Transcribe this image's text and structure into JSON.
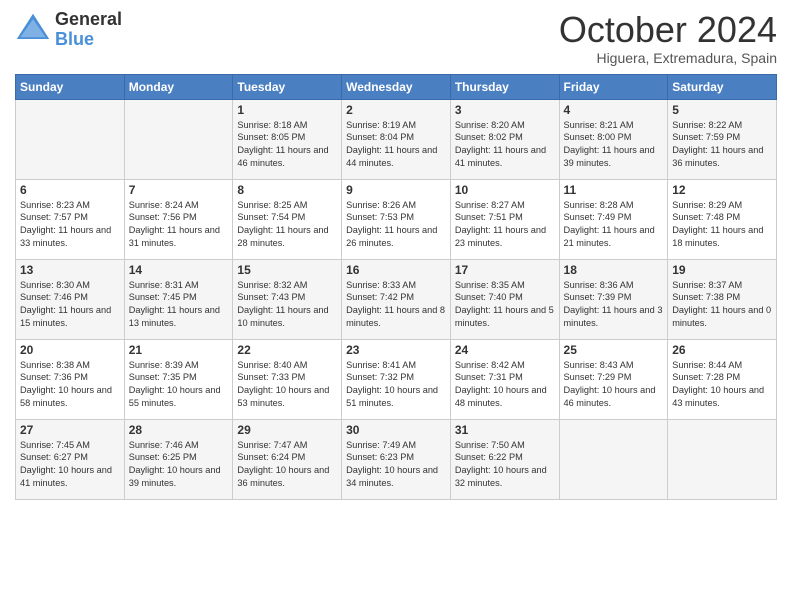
{
  "header": {
    "logo_line1": "General",
    "logo_line2": "Blue",
    "month": "October 2024",
    "location": "Higuera, Extremadura, Spain"
  },
  "days_of_week": [
    "Sunday",
    "Monday",
    "Tuesday",
    "Wednesday",
    "Thursday",
    "Friday",
    "Saturday"
  ],
  "weeks": [
    [
      {
        "day": "",
        "info": ""
      },
      {
        "day": "",
        "info": ""
      },
      {
        "day": "1",
        "info": "Sunrise: 8:18 AM\nSunset: 8:05 PM\nDaylight: 11 hours and 46 minutes."
      },
      {
        "day": "2",
        "info": "Sunrise: 8:19 AM\nSunset: 8:04 PM\nDaylight: 11 hours and 44 minutes."
      },
      {
        "day": "3",
        "info": "Sunrise: 8:20 AM\nSunset: 8:02 PM\nDaylight: 11 hours and 41 minutes."
      },
      {
        "day": "4",
        "info": "Sunrise: 8:21 AM\nSunset: 8:00 PM\nDaylight: 11 hours and 39 minutes."
      },
      {
        "day": "5",
        "info": "Sunrise: 8:22 AM\nSunset: 7:59 PM\nDaylight: 11 hours and 36 minutes."
      }
    ],
    [
      {
        "day": "6",
        "info": "Sunrise: 8:23 AM\nSunset: 7:57 PM\nDaylight: 11 hours and 33 minutes."
      },
      {
        "day": "7",
        "info": "Sunrise: 8:24 AM\nSunset: 7:56 PM\nDaylight: 11 hours and 31 minutes."
      },
      {
        "day": "8",
        "info": "Sunrise: 8:25 AM\nSunset: 7:54 PM\nDaylight: 11 hours and 28 minutes."
      },
      {
        "day": "9",
        "info": "Sunrise: 8:26 AM\nSunset: 7:53 PM\nDaylight: 11 hours and 26 minutes."
      },
      {
        "day": "10",
        "info": "Sunrise: 8:27 AM\nSunset: 7:51 PM\nDaylight: 11 hours and 23 minutes."
      },
      {
        "day": "11",
        "info": "Sunrise: 8:28 AM\nSunset: 7:49 PM\nDaylight: 11 hours and 21 minutes."
      },
      {
        "day": "12",
        "info": "Sunrise: 8:29 AM\nSunset: 7:48 PM\nDaylight: 11 hours and 18 minutes."
      }
    ],
    [
      {
        "day": "13",
        "info": "Sunrise: 8:30 AM\nSunset: 7:46 PM\nDaylight: 11 hours and 15 minutes."
      },
      {
        "day": "14",
        "info": "Sunrise: 8:31 AM\nSunset: 7:45 PM\nDaylight: 11 hours and 13 minutes."
      },
      {
        "day": "15",
        "info": "Sunrise: 8:32 AM\nSunset: 7:43 PM\nDaylight: 11 hours and 10 minutes."
      },
      {
        "day": "16",
        "info": "Sunrise: 8:33 AM\nSunset: 7:42 PM\nDaylight: 11 hours and 8 minutes."
      },
      {
        "day": "17",
        "info": "Sunrise: 8:35 AM\nSunset: 7:40 PM\nDaylight: 11 hours and 5 minutes."
      },
      {
        "day": "18",
        "info": "Sunrise: 8:36 AM\nSunset: 7:39 PM\nDaylight: 11 hours and 3 minutes."
      },
      {
        "day": "19",
        "info": "Sunrise: 8:37 AM\nSunset: 7:38 PM\nDaylight: 11 hours and 0 minutes."
      }
    ],
    [
      {
        "day": "20",
        "info": "Sunrise: 8:38 AM\nSunset: 7:36 PM\nDaylight: 10 hours and 58 minutes."
      },
      {
        "day": "21",
        "info": "Sunrise: 8:39 AM\nSunset: 7:35 PM\nDaylight: 10 hours and 55 minutes."
      },
      {
        "day": "22",
        "info": "Sunrise: 8:40 AM\nSunset: 7:33 PM\nDaylight: 10 hours and 53 minutes."
      },
      {
        "day": "23",
        "info": "Sunrise: 8:41 AM\nSunset: 7:32 PM\nDaylight: 10 hours and 51 minutes."
      },
      {
        "day": "24",
        "info": "Sunrise: 8:42 AM\nSunset: 7:31 PM\nDaylight: 10 hours and 48 minutes."
      },
      {
        "day": "25",
        "info": "Sunrise: 8:43 AM\nSunset: 7:29 PM\nDaylight: 10 hours and 46 minutes."
      },
      {
        "day": "26",
        "info": "Sunrise: 8:44 AM\nSunset: 7:28 PM\nDaylight: 10 hours and 43 minutes."
      }
    ],
    [
      {
        "day": "27",
        "info": "Sunrise: 7:45 AM\nSunset: 6:27 PM\nDaylight: 10 hours and 41 minutes."
      },
      {
        "day": "28",
        "info": "Sunrise: 7:46 AM\nSunset: 6:25 PM\nDaylight: 10 hours and 39 minutes."
      },
      {
        "day": "29",
        "info": "Sunrise: 7:47 AM\nSunset: 6:24 PM\nDaylight: 10 hours and 36 minutes."
      },
      {
        "day": "30",
        "info": "Sunrise: 7:49 AM\nSunset: 6:23 PM\nDaylight: 10 hours and 34 minutes."
      },
      {
        "day": "31",
        "info": "Sunrise: 7:50 AM\nSunset: 6:22 PM\nDaylight: 10 hours and 32 minutes."
      },
      {
        "day": "",
        "info": ""
      },
      {
        "day": "",
        "info": ""
      }
    ]
  ]
}
